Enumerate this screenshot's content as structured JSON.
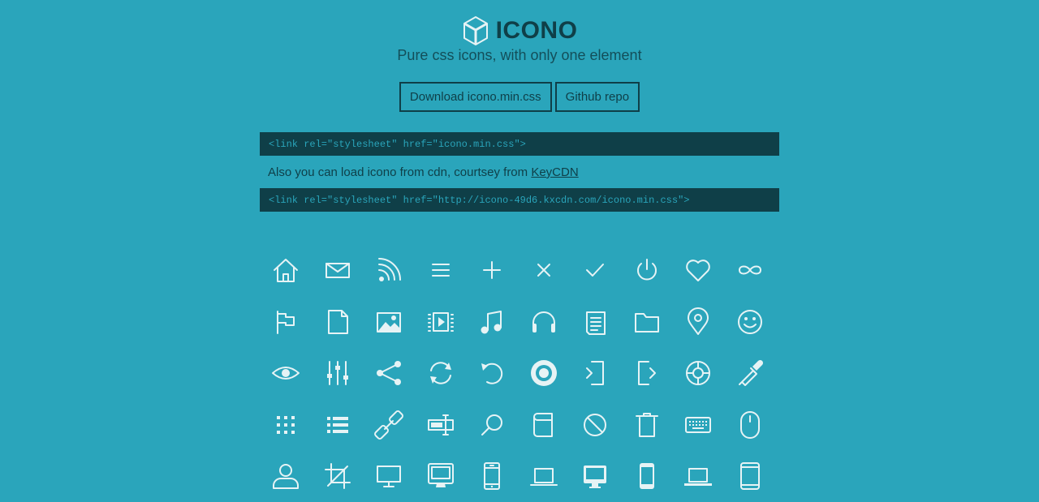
{
  "header": {
    "logo_icon": "cube-icon",
    "title": "ICONO",
    "subtitle": "Pure css icons, with only one element"
  },
  "buttons": {
    "download": "Download icono.min.css",
    "github": "Github repo"
  },
  "code": {
    "local": "<link rel=\"stylesheet\" href=\"icono.min.css\">",
    "cdn": "<link rel=\"stylesheet\" href=\"http://icono-49d6.kxcdn.com/icono.min.css\">"
  },
  "note": {
    "text": "Also you can load icono from cdn, courtsey from ",
    "link": "KeyCDN"
  },
  "colors": {
    "background": "#2aa5bb",
    "dark": "#0f3f48",
    "icon": "#e6f3f5"
  },
  "icons": [
    [
      "home-icon",
      "mail-icon",
      "rss-icon",
      "hamburger-icon",
      "plus-icon",
      "cross-icon",
      "check-icon",
      "power-icon",
      "heart-icon",
      "infinity-icon"
    ],
    [
      "flag-icon",
      "file-icon",
      "image-icon",
      "video-icon",
      "music-icon",
      "headphone-icon",
      "document-icon",
      "folder-icon",
      "pin-icon",
      "smile-icon"
    ],
    [
      "eye-icon",
      "sliders-icon",
      "share-icon",
      "sync-icon",
      "reset-icon",
      "disc-icon",
      "sign-in-icon",
      "sign-out-icon",
      "support-icon",
      "dropper-icon"
    ],
    [
      "keypad-icon",
      "list-icon",
      "link-icon",
      "text-cursor-icon",
      "search-icon",
      "book-icon",
      "forbidden-icon",
      "trash-icon",
      "keyboard-icon",
      "mouse-icon"
    ],
    [
      "user-icon",
      "crop-icon",
      "display-icon",
      "imac-icon",
      "iphone-icon",
      "macbook-icon",
      "imac-bold-icon",
      "iphone-bold-icon",
      "laptop-icon",
      "tablet-icon"
    ]
  ]
}
